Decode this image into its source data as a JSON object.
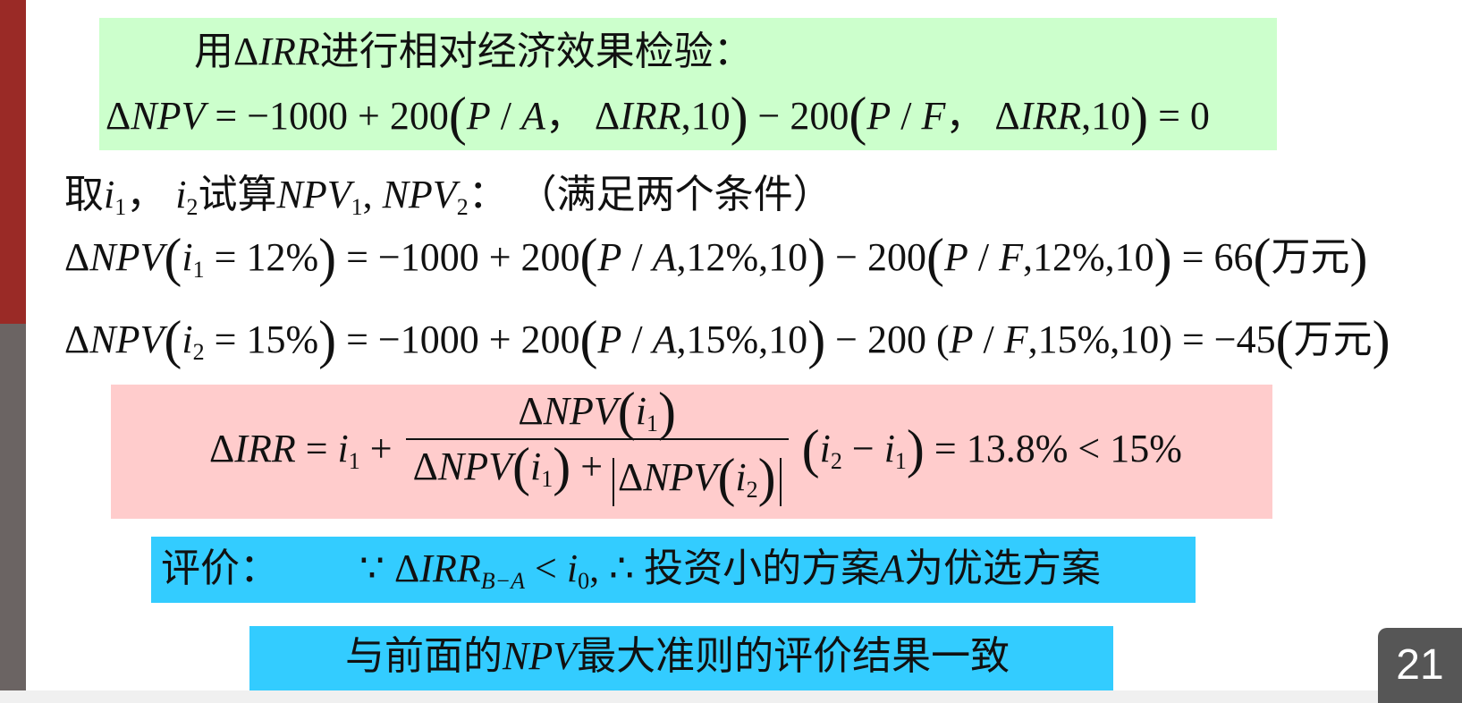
{
  "line1": {
    "a": "用",
    "b": "Δ",
    "c": "IRR",
    "d": "进行相对经济效果检验："
  },
  "line2": {
    "a": "Δ",
    "b": "NPV",
    "c": " = −1000 + 200",
    "d": "(",
    "e": "P",
    "f": " / ",
    "g": "A",
    "h": "，  Δ",
    "k": "IRR",
    "l": ",10",
    "m": ")",
    "n": " − 200",
    "o": "(",
    "p": "P",
    "q": " / ",
    "r": "F",
    "s": "，  Δ",
    "t": "IRR",
    "u": ",10",
    "v": ")",
    "w": " = 0"
  },
  "line3": {
    "a": "取",
    "b": "i",
    "c": "1",
    "d": "，  ",
    "e": "i",
    "f": "2",
    "g": "试算",
    "h": "NPV",
    "k": "1",
    "l": ", ",
    "m": "NPV",
    "n": "2",
    "o": "：     （满足两个条件）"
  },
  "line4": {
    "a": "Δ",
    "b": "NPV",
    "c": "(",
    "d": "i",
    "e": "1",
    "f": " = 12%",
    "g": ")",
    "h": " = −1000 + 200",
    "k": "(",
    "l": "P",
    "m": " / ",
    "n": "A",
    "o": ",12%,10",
    "p": ")",
    "q": " − 200",
    "r": "(",
    "s": "P",
    "t": " / ",
    "u": "F",
    "v": ",12%,10",
    "w": ")",
    "x": " = 66",
    "y": "(",
    "z": "万元",
    "zz": ")"
  },
  "line5": {
    "a": "Δ",
    "b": "NPV",
    "c": "(",
    "d": "i",
    "e": "2",
    "f": " = 15%",
    "g": ")",
    "h": " = −1000 + 200",
    "k": "(",
    "l": "P",
    "m": " / ",
    "n": "A",
    "o": ",15%,10",
    "p": ")",
    "q": " − 200 (",
    "s": "P",
    "t": " / ",
    "u": "F",
    "v": ",15%,10)  = −45",
    "y": "(",
    "z": "万元",
    "zz": ")"
  },
  "formula": {
    "lhs_delta": "Δ",
    "lhs_irr": "IRR",
    "eq": " = ",
    "i": "i",
    "i_sub": "1",
    "plus": " + ",
    "num_delta": "Δ",
    "num_npv": "NPV",
    "num_open": "(",
    "num_i": "i",
    "num_sub": "1",
    "num_close": ")",
    "den_delta1": "Δ",
    "den_npv1": "NPV",
    "den_open1": "(",
    "den_i1": "i",
    "den_sub1": "1",
    "den_close1": ")",
    "den_plus": " + ",
    "den_delta2": "Δ",
    "den_npv2": "NPV",
    "den_open2": "(",
    "den_i2": "i",
    "den_sub2": "2",
    "den_close2": ")",
    "t_open": "(",
    "t_i2": "i",
    "t_s2": "2",
    "t_minus": " − ",
    "t_i1": "i",
    "t_s1": "1",
    "t_close": ")",
    "result": " = 13.8% < 15%"
  },
  "eval": {
    "a": "评价：",
    "b": "∵ Δ",
    "c": "IRR",
    "d": "B−A",
    "e": " < ",
    "f": "i",
    "g": "0",
    "h": ", ∴ 投资小的方案",
    "k": "A",
    "l": "为优选方案"
  },
  "conclusion": {
    "a": "与前面的",
    "b": "NPV",
    "c": "最大准则的评价结果一致"
  },
  "page_number": "21"
}
